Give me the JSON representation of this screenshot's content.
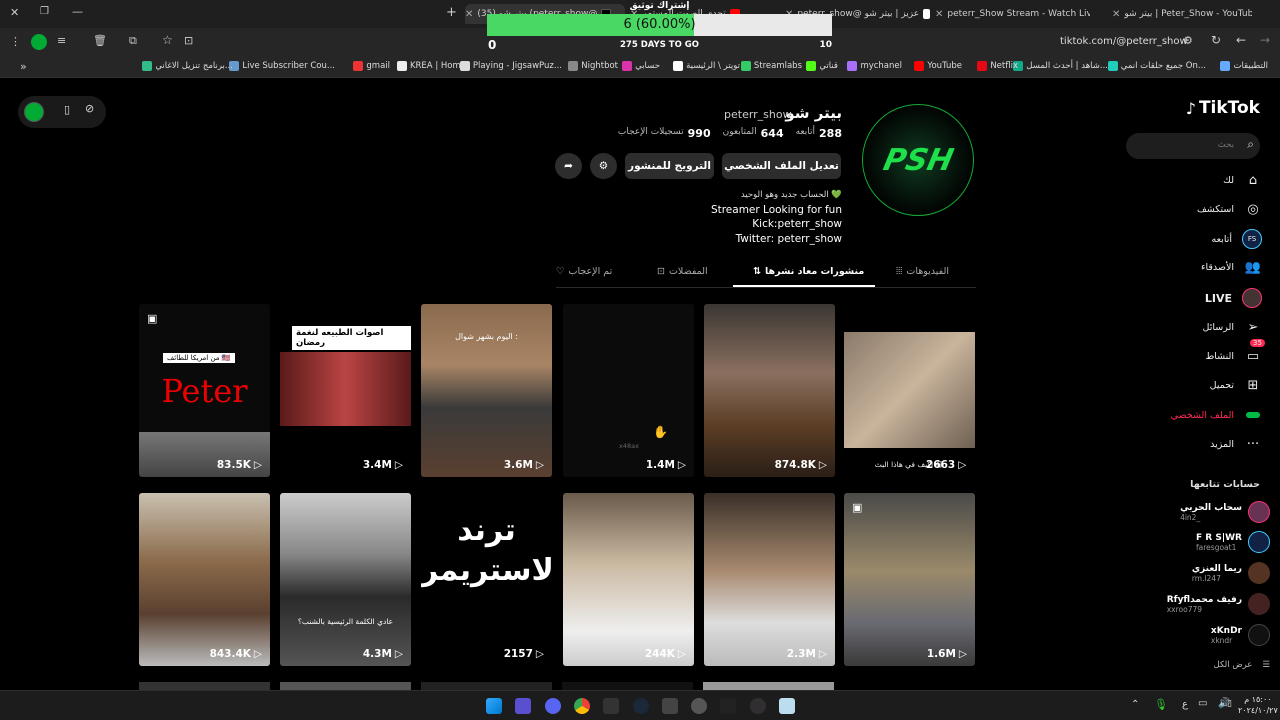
{
  "browser": {
    "tabs": [
      {
        "title": "Peter_Show - YouTube | بيتر شو"
      },
      {
        "title": "peterr_Show Stream - Watch Live"
      },
      {
        "title": "عزيز | بيتر شو @peterr_show"
      },
      {
        "title": "تحدي الصوت المستمر"
      },
      {
        "title": "@peterr_show) بيتر شو (35)"
      }
    ],
    "address": "tiktok.com/@peterr_show",
    "bookmarks": [
      "التطبيقات",
      "جميع حلقات انمي On...",
      "شاهد | أحدث المسل...",
      "Netflix",
      "YouTube",
      "mychanel",
      "قناتي",
      "Streamlabs",
      "تويتر \\ الرئيسية",
      "حسابي",
      "Nightbot",
      "Playing - JigsawPuz...",
      "KREA | Home",
      "gmail",
      "Live Subscriber Cou...",
      "برنامج تنزيل الاغاني..."
    ]
  },
  "overlay": {
    "title": "إشتراك توثيق",
    "progress_text": "6 (60.00%)",
    "progress": 0.6,
    "left": "0",
    "center": "275 DAYS TO GO",
    "right": "10"
  },
  "sidebar": {
    "logo": "TikTok",
    "search_placeholder": "بحث",
    "items": [
      {
        "label": "لك",
        "icon": "home-icon"
      },
      {
        "label": "استكشف",
        "icon": "compass-icon"
      },
      {
        "label": "أتابعه",
        "icon": "following-icon"
      },
      {
        "label": "الأصدقاء",
        "icon": "friends-icon"
      },
      {
        "label": "LIVE",
        "icon": "live-icon"
      },
      {
        "label": "الرسائل",
        "icon": "send-icon"
      },
      {
        "label": "النشاط",
        "icon": "inbox-icon",
        "badge": "35"
      },
      {
        "label": "تحميل",
        "icon": "upload-icon"
      },
      {
        "label": "الملف الشخصي",
        "icon": "profile-icon"
      },
      {
        "label": "المزيد",
        "icon": "more-icon"
      }
    ],
    "following_title": "حسابات تتابعها",
    "following": [
      {
        "name": "سحاب الحربي",
        "user": "_4in2"
      },
      {
        "name": "F R S|WR",
        "user": "faresgoat1"
      },
      {
        "name": "ريما العنزي",
        "user": "rm.l247"
      },
      {
        "name": "Rfyflرفيف محمد",
        "user": "xxroo779"
      },
      {
        "name": "xKnDr",
        "user": "xkndr"
      }
    ],
    "see_all": "عرض الكل"
  },
  "profile": {
    "display_name": "بيتر شو",
    "username": "peterr_show",
    "stats": [
      {
        "num": "288",
        "label": "أتابعه"
      },
      {
        "num": "644",
        "label": "المتابعون"
      },
      {
        "num": "990",
        "label": "تسجيلات الإعجاب"
      }
    ],
    "edit_button": "تعديل الملف الشخصي",
    "promote_button": "الترويج للمنشور",
    "bio": [
      "الحساب جديد وهو الوحيد 💚",
      "Streamer Looking for fun",
      "Kick:peterr_show",
      "Twitter: peterr_show"
    ],
    "avatar_text": "PSH",
    "tabs": [
      "الفيديوهات",
      "منشورات معاد نشرها",
      "المفضلات",
      "تم الإعجاب"
    ]
  },
  "videos": [
    {
      "count": "2663",
      "caption": "اكيف في هاذا البث 😂"
    },
    {
      "count": "874.8K"
    },
    {
      "count": "1.4M",
      "caption": "x48ax"
    },
    {
      "count": "3.6M",
      "caption": "اليوم بشهر شوال :"
    },
    {
      "count": "3.4M",
      "caption": "اصوات الطبيعه لنغمة رمضان"
    },
    {
      "count": "83.5K",
      "caption": "Peter",
      "caption2": "من امريكا للطائف 🇺🇸"
    },
    {
      "count": "1.6M"
    },
    {
      "count": "2.3M"
    },
    {
      "count": "244K"
    },
    {
      "count": "2157",
      "caption": "ترند الاستريمر"
    },
    {
      "count": "4.3M",
      "caption": "عادي الكلمة الرئيسية بالشنب؟"
    },
    {
      "count": "843.4K"
    }
  ],
  "taskbar": {
    "time": "١٥:٠٠ م",
    "date": "٢٠٢٤/١٠/٢٧",
    "lang": "ع"
  }
}
